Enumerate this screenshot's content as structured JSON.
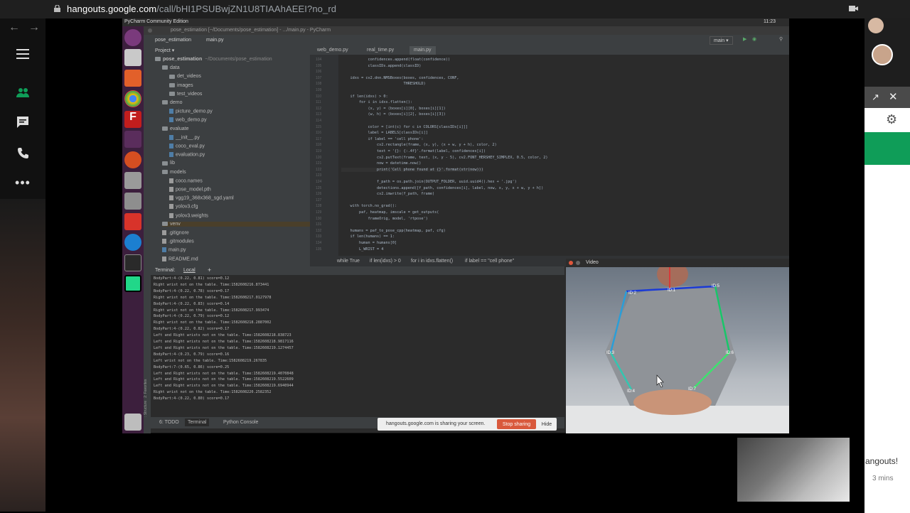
{
  "browser": {
    "url_host": "hangouts.google.com",
    "url_path": "/call/bHI1PSUBwjZN1U8TIAAhAEEI?no_rd"
  },
  "ubuntu": {
    "title": "PyCharm Community Edition",
    "clock": "11:23"
  },
  "pycharm": {
    "window_title": "pose_estimation [~/Documents/pose_estimation] - .../main.py - PyCharm",
    "nav_project": "pose_estimation",
    "nav_file": "main.py",
    "run_config": "main",
    "project_label": "Project",
    "tree": [
      {
        "label": "pose_estimation",
        "extra": "~/Documents/pose_estimation",
        "type": "root",
        "depth": 0
      },
      {
        "label": "data",
        "type": "folder",
        "depth": 1
      },
      {
        "label": "det_videos",
        "type": "folder",
        "depth": 2
      },
      {
        "label": "images",
        "type": "folder",
        "depth": 2
      },
      {
        "label": "test_videos",
        "type": "folder",
        "depth": 2
      },
      {
        "label": "demo",
        "type": "folder",
        "depth": 1
      },
      {
        "label": "picture_demo.py",
        "type": "py",
        "depth": 2
      },
      {
        "label": "web_demo.py",
        "type": "py",
        "depth": 2
      },
      {
        "label": "evaluate",
        "type": "folder",
        "depth": 1
      },
      {
        "label": "__init__.py",
        "type": "py",
        "depth": 2
      },
      {
        "label": "coco_eval.py",
        "type": "py",
        "depth": 2
      },
      {
        "label": "evaluation.py",
        "type": "py",
        "depth": 2
      },
      {
        "label": "lib",
        "type": "folder",
        "depth": 1
      },
      {
        "label": "models",
        "type": "folder",
        "depth": 1
      },
      {
        "label": "coco.names",
        "type": "file",
        "depth": 2
      },
      {
        "label": "pose_model.pth",
        "type": "file",
        "depth": 2
      },
      {
        "label": "vgg19_368x368_sgd.yaml",
        "type": "file",
        "depth": 2
      },
      {
        "label": "yolov3.cfg",
        "type": "file",
        "depth": 2
      },
      {
        "label": "yolov3.weights",
        "type": "file",
        "depth": 2
      },
      {
        "label": "venv",
        "type": "folder",
        "depth": 1
      },
      {
        "label": ".gitignore",
        "type": "file",
        "depth": 1
      },
      {
        "label": ".gitmodules",
        "type": "file",
        "depth": 1
      },
      {
        "label": "main.py",
        "type": "py",
        "depth": 1
      },
      {
        "label": "README.md",
        "type": "file",
        "depth": 1
      }
    ],
    "editor_tabs": [
      "web_demo.py",
      "real_time.py",
      "main.py"
    ],
    "code_lines": [
      {
        "n": "104",
        "t": "            confidences.append(float(confidence))"
      },
      {
        "n": "105",
        "t": "            classIDs.append(classID)"
      },
      {
        "n": "106",
        "t": ""
      },
      {
        "n": "107",
        "t": "    idxs = cv2.dnn.NMSBoxes(boxes, confidences, CONF,"
      },
      {
        "n": "108",
        "t": "                            THRESHOLD)"
      },
      {
        "n": "109",
        "t": ""
      },
      {
        "n": "110",
        "t": "    if len(idxs) > 0:"
      },
      {
        "n": "111",
        "t": "        for i in idxs.flatten():"
      },
      {
        "n": "112",
        "t": "            (x, y) = (boxes[i][0], boxes[i][1])"
      },
      {
        "n": "113",
        "t": "            (w, h) = (boxes[i][2], boxes[i][3])"
      },
      {
        "n": "114",
        "t": ""
      },
      {
        "n": "115",
        "t": "            color = [int(c) for c in COLORS[classIDs[i]]]"
      },
      {
        "n": "116",
        "t": "            label = LABELS[classIDs[i]]"
      },
      {
        "n": "117",
        "t": "            if label == 'cell phone':"
      },
      {
        "n": "118",
        "t": "                cv2.rectangle(frame, (x, y), (x + w, y + h), color, 2)"
      },
      {
        "n": "119",
        "t": "                text = '{}: {:.4f}'.format(label, confidences[i])"
      },
      {
        "n": "120",
        "t": "                cv2.putText(frame, text, (x, y - 5), cv2.FONT_HERSHEY_SIMPLEX, 0.5, color, 2)"
      },
      {
        "n": "121",
        "t": "                now = datetime.now()"
      },
      {
        "n": "122",
        "t": "                print('Cell phone found at {}'.format(str(now)))"
      },
      {
        "n": "123",
        "t": ""
      },
      {
        "n": "124",
        "t": "                f_path = os.path.join(OUTPUT_FOLDER, uuid.uuid4().hex + '.jpg')"
      },
      {
        "n": "125",
        "t": "                detections.append([f_path, confidences[i], label, now, x, y, x + w, y + h])"
      },
      {
        "n": "126",
        "t": "                cv2.imwrite(f_path, frame)"
      },
      {
        "n": "127",
        "t": ""
      },
      {
        "n": "128",
        "t": "    with torch.no_grad():"
      },
      {
        "n": "129",
        "t": "        paf, heatmap, imscale = get_outputs("
      },
      {
        "n": "130",
        "t": "            frameOrig, model, 'rtpose')"
      },
      {
        "n": "131",
        "t": ""
      },
      {
        "n": "132",
        "t": "    humans = paf_to_pose_cpp(heatmap, paf, cfg)"
      },
      {
        "n": "133",
        "t": "    if len(humans) == 1:"
      },
      {
        "n": "134",
        "t": "        human = humans[0]"
      },
      {
        "n": "135",
        "t": "        L_WRIST = 4"
      }
    ],
    "breadcrumbs": [
      "while True",
      "if len(idxs) > 0",
      "for i in idxs.flatten()",
      "if label == \"cell phone\""
    ],
    "terminal_label": "Terminal:",
    "terminal_tab": "Local",
    "terminal_lines": [
      "BodyPart:4-(0.22, 0.81) score=0.12",
      "Right wrist not on the table. Time:1582608216.873441",
      "BodyPart:4-(0.22, 0.78) score=0.17",
      "Right wrist not on the table. Time:1582608217.0127978",
      "BodyPart:4-(0.22, 0.83) score=0.14",
      "Right wrist not on the table. Time:1582608217.993474",
      "BodyPart:4-(0.22, 0.79) score=0.12",
      "Right wrist not on the table. Time:1582608218.2887002",
      "BodyPart:4-(0.22, 0.82) score=0.17",
      "Left and Right wrists not on the table. Time:1582608218.838723",
      "Left and Right wrists not on the table. Time:1582608218.9817116",
      "Left and Right wrists not on the table. Time:1582608219.1274457",
      "BodyPart:4-(0.23, 0.79) score=0.16",
      "Left wrist not on the table. Time:1582608219.267835",
      "BodyPart:7-(0.65, 0.86) score=0.25",
      "Left and Right wrists not on the table. Time:1582608219.4070848",
      "Left and Right wrists not on the table. Time:1582608219.5522609",
      "Left and Right wrists not on the table. Time:1582608219.6940944",
      "Right wrist not on the table. Time:1582608220.2582352",
      "BodyPart:4-(0.22, 0.80) score=0.17"
    ],
    "status_tabs": [
      "6: TODO",
      "Terminal",
      "Python Console"
    ],
    "side_labels": [
      "Z: Structure",
      "2: Favorites"
    ]
  },
  "video": {
    "title": "Video",
    "joints": [
      "ID:2",
      "ID:5",
      "ID:3",
      "ID:6",
      "ID:4",
      "ID:7",
      "ID:1"
    ]
  },
  "share_banner": {
    "text": "hangouts.google.com is sharing your screen.",
    "stop": "Stop sharing",
    "hide": "Hide"
  },
  "right_panel": {
    "partial_text": "angouts!",
    "time": "3 mins"
  }
}
